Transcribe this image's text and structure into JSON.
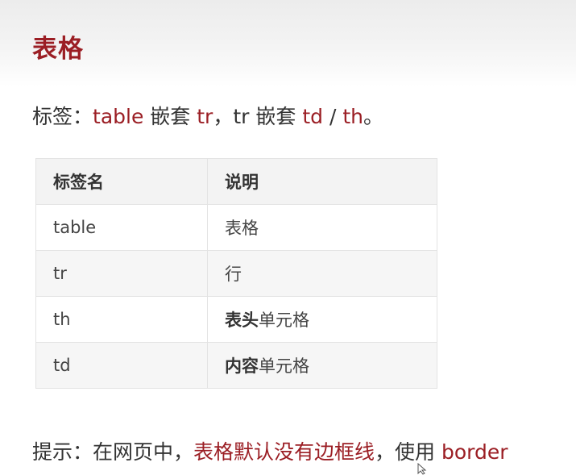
{
  "title": "表格",
  "intro": {
    "prefix": "标签：",
    "table": "table",
    "nest1": " 嵌套 ",
    "tr1": "tr",
    "sep": "，",
    "tr2": "tr",
    "nest2": " 嵌套 ",
    "td": "td",
    "slash": " / ",
    "th": "th",
    "end": "。"
  },
  "table": {
    "headers": [
      "标签名",
      "说明"
    ],
    "rows": [
      {
        "name": "table",
        "bold": "",
        "desc": "表格"
      },
      {
        "name": "tr",
        "bold": "",
        "desc": "行"
      },
      {
        "name": "th",
        "bold": "表头",
        "desc": "单元格"
      },
      {
        "name": "td",
        "bold": "内容",
        "desc": "单元格"
      }
    ]
  },
  "tip": {
    "prefix": "提示：在网页中，",
    "highlight": "表格默认没有边框线",
    "middle": "，使用 ",
    "keyword": "border"
  },
  "colors": {
    "accent": "#9b1e24",
    "text": "#333333",
    "header_bg": "#f3f3f3",
    "border": "#e3e3e3"
  }
}
